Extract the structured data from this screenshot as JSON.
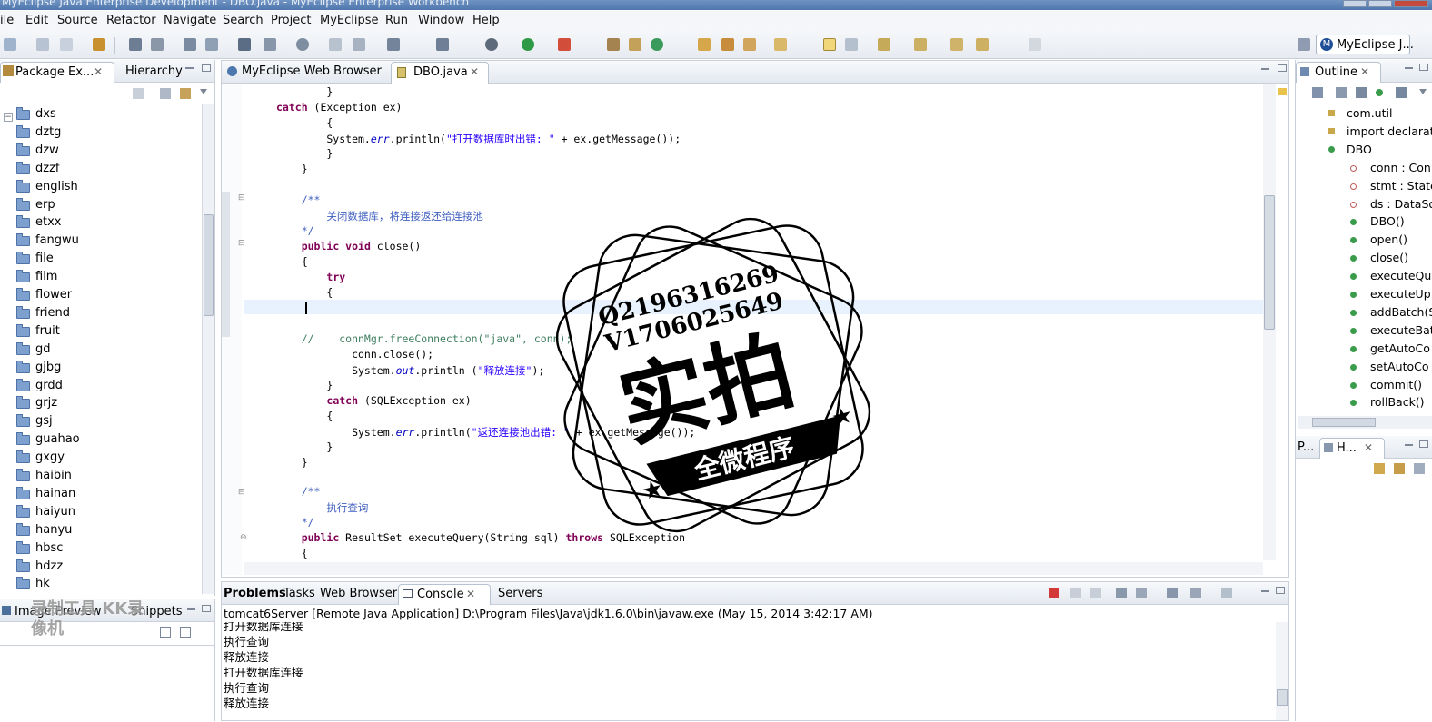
{
  "window": {
    "title": "MyEclipse Java Enterprise Development - DBO.java - MyEclipse Enterprise Workbench"
  },
  "menu": [
    "File",
    "Edit",
    "Source",
    "Refactor",
    "Navigate",
    "Search",
    "Project",
    "MyEclipse",
    "Run",
    "Window",
    "Help"
  ],
  "menu_visible": [
    "ile",
    "Edit",
    "Source",
    "Refactor",
    "Navigate",
    "Search",
    "Project",
    "MyEclipse",
    "Run",
    "Window",
    "Help"
  ],
  "toolbar": {
    "perspective": "MyEclipse J..."
  },
  "left_panel": {
    "tabs": [
      "Package Ex...",
      "Hierarchy"
    ],
    "tree": [
      "dxs",
      "dztg",
      "dzw",
      "dzzf",
      "english",
      "erp",
      "etxx",
      "fangwu",
      "file",
      "film",
      "flower",
      "friend",
      "fruit",
      "gd",
      "gjbg",
      "grdd",
      "grjz",
      "gsj",
      "guahao",
      "gxgy",
      "haibin",
      "hainan",
      "haiyun",
      "hanyu",
      "hbsc",
      "hdzz",
      "hk"
    ]
  },
  "left_bottom_panel": {
    "tabs": [
      "Image Preview",
      "Snippets"
    ]
  },
  "editor": {
    "tabs": [
      "MyEclipse Web Browser",
      "DBO.java"
    ],
    "lines": [
      "        }",
      "        catch (Exception ex)",
      "        {",
      "        System.err.println(\"打开数据库时出错: \" + ex.getMessage());",
      "        }",
      "    }",
      "",
      "    /**",
      "        关闭数据库，将连接返还给连接池",
      "    */",
      "    public void close()",
      "    {",
      "        try",
      "        {",
      "        |",
      "",
      "    //    connMgr.freeConnection(\"java\", conn);",
      "            conn.close();",
      "            System.out.println (\"释放连接\");",
      "        }",
      "        catch (SQLException ex)",
      "        {",
      "            System.err.println(\"返还连接池出错: \" + ex.getMessage());",
      "        }",
      "    }",
      "",
      "    /**",
      "        执行查询",
      "    */",
      "    public ResultSet executeQuery(String sql) throws SQLException",
      "    {"
    ]
  },
  "outline": {
    "tab": "Outline",
    "items": [
      "com.util",
      "import declarations",
      "DBO",
      "conn : Connection",
      "stmt : Statement",
      "ds : DataSource",
      "DBO()",
      "open()",
      "close()",
      "executeQuery(String)",
      "executeUpdate(String)",
      "addBatch(String)",
      "executeBatch()",
      "getAutoCommit()",
      "setAutoCommit(boolean)",
      "commit()",
      "rollBack()"
    ],
    "items_visible": [
      "com.util",
      "import declarat",
      "DBO",
      "conn : Con",
      "stmt : State",
      "ds : DataSo",
      "DBO()",
      "open()",
      "close()",
      "executeQu",
      "executeUp",
      "addBatch(S",
      "executeBat",
      "getAutoCo",
      "setAutoCo",
      "commit()",
      "rollBack()"
    ]
  },
  "right_bottom_panel": {
    "tabs": [
      "P...",
      "H..."
    ]
  },
  "console": {
    "tabs": [
      "Problems",
      "Tasks",
      "Web Browser",
      "Console",
      "Servers"
    ],
    "header": "tomcat6Server [Remote Java Application] D:\\Program Files\\Java\\jdk1.6.0\\bin\\javaw.exe (May 15, 2014 3:42:17 AM)",
    "lines": [
      "打开数据库连接",
      "执行查询",
      "释放连接",
      "打开数据库连接",
      "执行查询",
      "释放连接"
    ]
  },
  "watermark": {
    "line1": "Q2196316269",
    "line2": "V1706025649",
    "big": "实拍",
    "banner": "全微程序",
    "corner_logo": "录制工具 KK录像机"
  },
  "colors": {
    "accent": "#4f77ad",
    "keyword": "#7f0055",
    "string": "#2a00ff",
    "comment": "#3f7f5f",
    "javadoc": "#3f5fbf"
  }
}
